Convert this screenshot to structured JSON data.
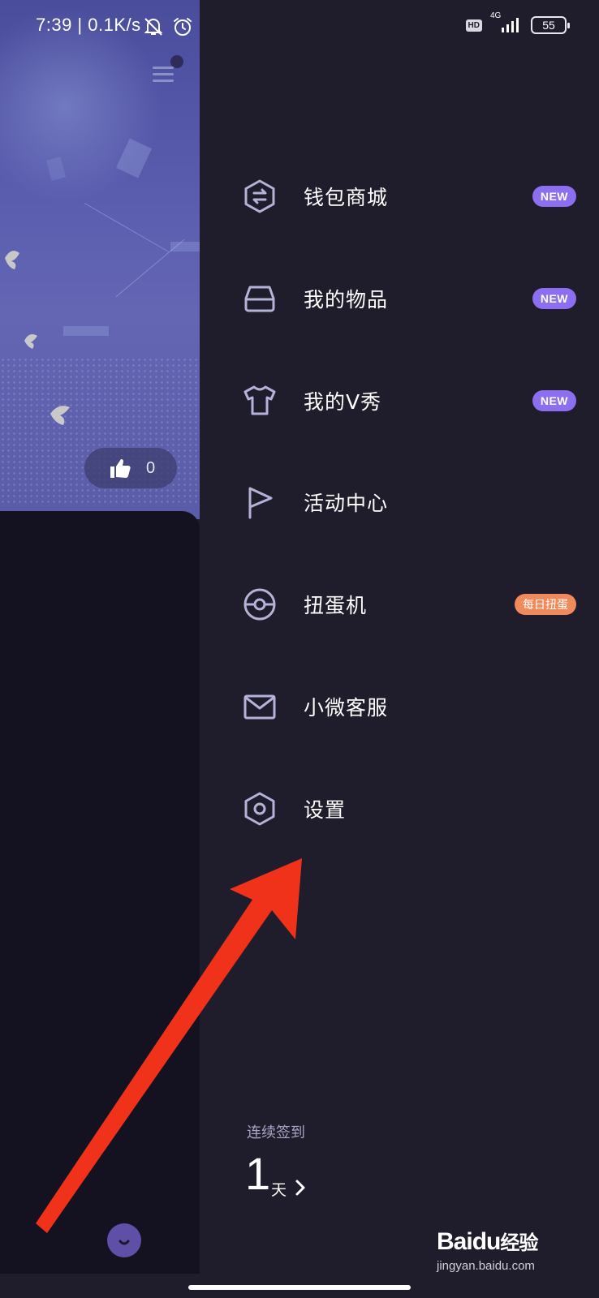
{
  "status_bar": {
    "time": "7:39 | 0.1K/s",
    "hd": "HD",
    "network": "4G",
    "battery": "55"
  },
  "left_page": {
    "like_count": "0"
  },
  "drawer": {
    "items": [
      {
        "label": "钱包商城",
        "icon": "wallet-exchange-icon",
        "badge": "NEW",
        "badge_type": "new"
      },
      {
        "label": "我的物品",
        "icon": "inbox-tray-icon",
        "badge": "NEW",
        "badge_type": "new"
      },
      {
        "label": "我的V秀",
        "icon": "tshirt-icon",
        "badge": "NEW",
        "badge_type": "new"
      },
      {
        "label": "活动中心",
        "icon": "flag-icon",
        "badge": "",
        "badge_type": ""
      },
      {
        "label": "扭蛋机",
        "icon": "capsule-ball-icon",
        "badge": "每日扭蛋",
        "badge_type": "orange"
      },
      {
        "label": "小微客服",
        "icon": "mail-icon",
        "badge": "",
        "badge_type": ""
      },
      {
        "label": "设置",
        "icon": "settings-hexagon-icon",
        "badge": "",
        "badge_type": ""
      }
    ],
    "checkin": {
      "title": "连续签到",
      "days": "1",
      "unit": "天"
    }
  },
  "watermark": {
    "logo_bai": "Bai",
    "logo_du": "du",
    "logo_cn": "经验",
    "url": "jingyan.baidu.com"
  },
  "colors": {
    "drawer_bg": "#1f1d2b",
    "icon_stroke": "#b4b2d6",
    "badge_new": "#8b6ff0",
    "badge_orange": "#f08a5a",
    "annotation_arrow": "#f0321a"
  }
}
